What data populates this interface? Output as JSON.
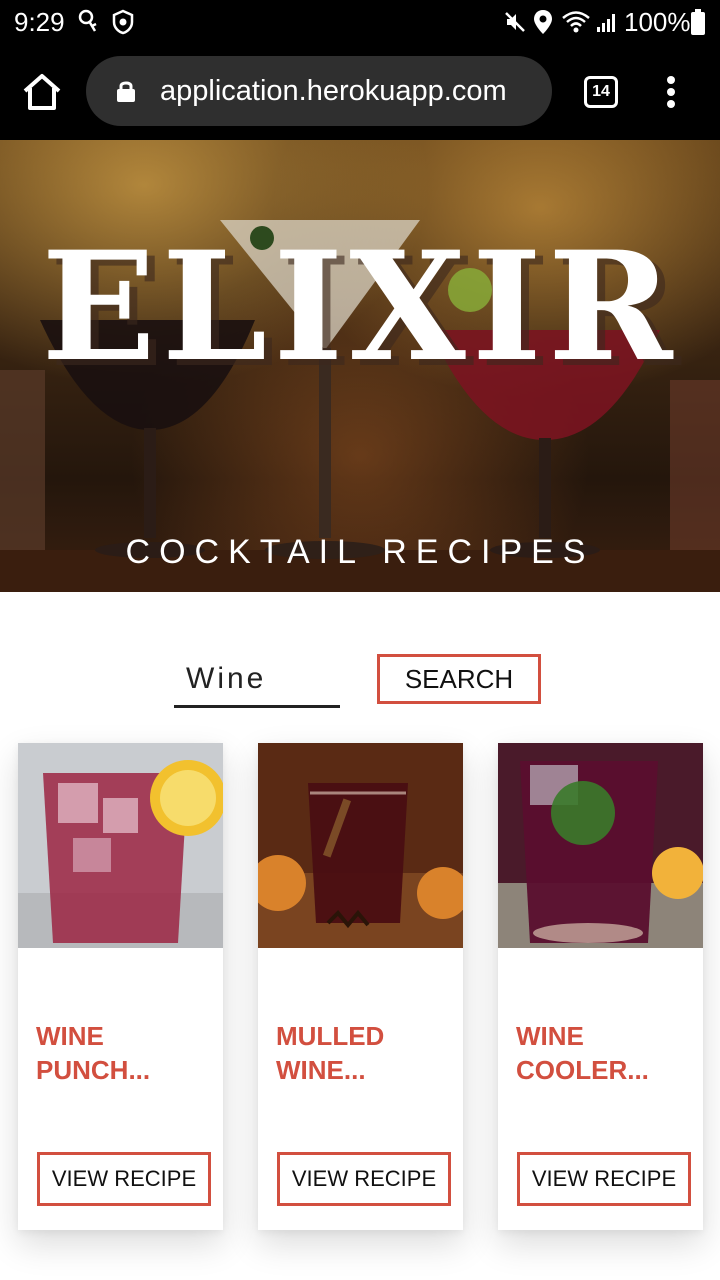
{
  "status_bar": {
    "time": "9:29",
    "battery": "100%",
    "icons": [
      "key-notification-icon",
      "shield-notification-icon",
      "mute-icon",
      "location-icon",
      "wifi-icon",
      "signal-icon",
      "battery-icon"
    ]
  },
  "browser": {
    "url": "application.herokuapp.com",
    "tab_count": "14"
  },
  "hero": {
    "title": "ELIXIR",
    "subtitle": "COCKTAIL RECIPES"
  },
  "search": {
    "value": "Wine",
    "button_label": "SEARCH"
  },
  "cards": [
    {
      "title": "WINE\nPUNCH...",
      "button_label": "VIEW RECIPE"
    },
    {
      "title": "MULLED\nWINE...",
      "button_label": "VIEW RECIPE"
    },
    {
      "title": "WINE\nCOOLER...",
      "button_label": "VIEW RECIPE"
    }
  ],
  "colors": {
    "accent": "#d24f3f",
    "browser_bar": "#000000",
    "url_pill": "#2f2f2f"
  }
}
